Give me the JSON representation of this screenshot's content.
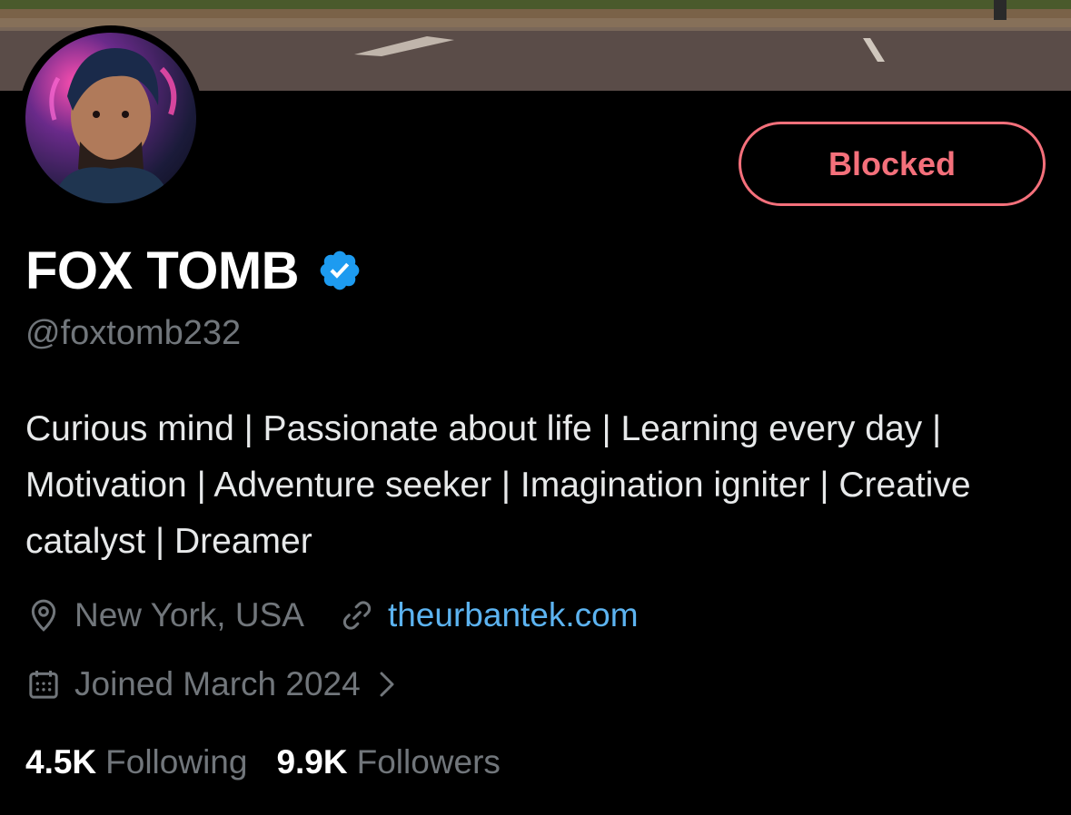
{
  "profile": {
    "display_name": "FOX TOMB",
    "handle": "@foxtomb232",
    "bio": "Curious mind | Passionate about life | Learning every day | Motivation | Adventure seeker | Imagination igniter | Creative catalyst | Dreamer",
    "location": "New York, USA",
    "website": "theurbantek.com",
    "joined": "Joined March 2024"
  },
  "actions": {
    "blocked_label": "Blocked"
  },
  "stats": {
    "following_count": "4.5K",
    "following_label": "Following",
    "followers_count": "9.9K",
    "followers_label": "Followers"
  },
  "icons": {
    "verified": "verified-badge-icon",
    "location": "location-pin-icon",
    "link": "link-icon",
    "calendar": "calendar-icon",
    "chevron": "chevron-right-icon"
  },
  "colors": {
    "background": "#000000",
    "blocked_accent": "#f4707b",
    "link": "#5cb3f0",
    "verified": "#1d9bf0",
    "secondary_text": "#71767b"
  }
}
